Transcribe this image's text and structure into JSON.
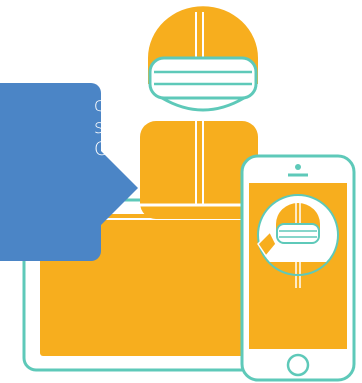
{
  "colors": {
    "accent_orange": "#f7ae1e",
    "outline_teal": "#5ec9b9",
    "bubble_blue": "#4b85c6",
    "background": "#ffffff"
  },
  "speech_bubble": {
    "lines": [
      "comes",
      "sion",
      "Chat"
    ]
  },
  "icons": {
    "headset": "headset-icon",
    "home_button": "home-button-icon",
    "earpiece": "earpiece-icon"
  }
}
